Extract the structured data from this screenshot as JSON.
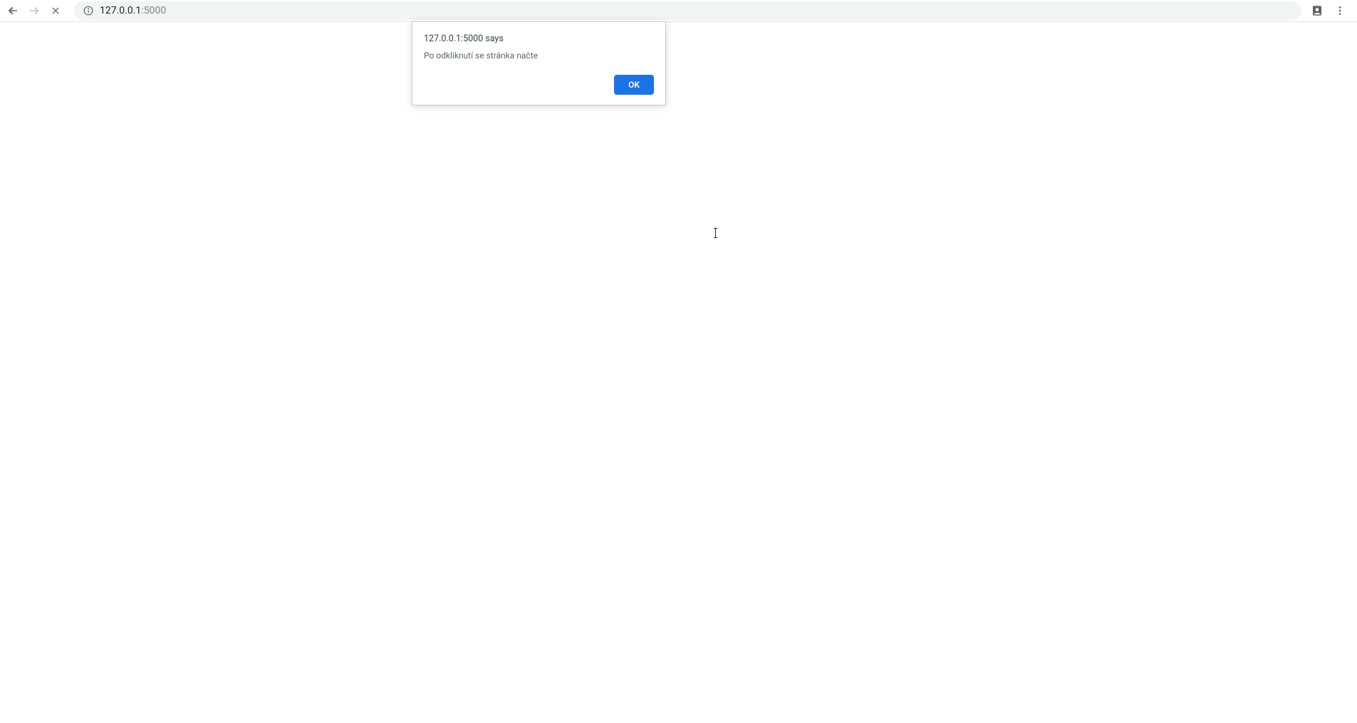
{
  "toolbar": {
    "url_host": "127.0.0.1",
    "url_port": ":5000"
  },
  "dialog": {
    "title": "127.0.0.1:5000 says",
    "message": "Po odkliknutí se stránka načte",
    "ok_label": "OK"
  }
}
